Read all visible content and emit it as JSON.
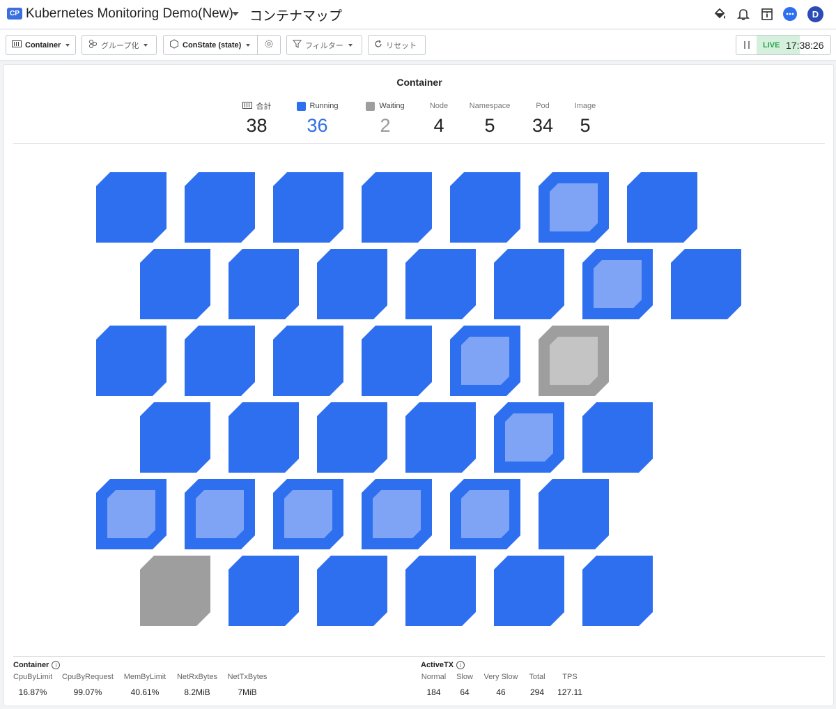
{
  "header": {
    "badge": "CP",
    "project_title": "Kubernetes Monitoring Demo(New)",
    "page_title": "コンテナマップ",
    "avatar_initial": "D"
  },
  "toolbar": {
    "container_label": "Container",
    "group_label": "グループ化",
    "state_label": "ConState (state)",
    "filter_label": "フィルター",
    "reset_label": "リセット",
    "live_label": "LIVE",
    "live_time": "17:38:26"
  },
  "summary": {
    "title": "Container",
    "stats": [
      {
        "label": "合計",
        "value": "38"
      },
      {
        "label": "Running",
        "value": "36"
      },
      {
        "label": "Waiting",
        "value": "2"
      },
      {
        "label": "Node",
        "value": "4"
      },
      {
        "label": "Namespace",
        "value": "5"
      },
      {
        "label": "Pod",
        "value": "34"
      },
      {
        "label": "Image",
        "value": "5"
      }
    ]
  },
  "colors": {
    "running": "#2e6ff0",
    "running_inner": "#7fa4f5",
    "waiting": "#9e9e9e",
    "waiting_inner": "#c4c4c4"
  },
  "map": {
    "rows": [
      [
        "running",
        "running",
        "running",
        "running",
        "running",
        "running-selected",
        "running"
      ],
      [
        "running",
        "running",
        "running",
        "running",
        "running",
        "running-selected",
        "running"
      ],
      [
        "running",
        "running",
        "running",
        "running",
        "running-selected",
        "waiting-selected"
      ],
      [
        "running",
        "running",
        "running",
        "running",
        "running-selected",
        "running"
      ],
      [
        "running-selected",
        "running-selected",
        "running-selected",
        "running-selected",
        "running-selected",
        "running"
      ],
      [
        "waiting",
        "running",
        "running",
        "running",
        "running",
        "running"
      ]
    ]
  },
  "container_metrics": {
    "title": "Container",
    "items": [
      {
        "label": "CpuByLimit",
        "value": "16.87%"
      },
      {
        "label": "CpuByRequest",
        "value": "99.07%"
      },
      {
        "label": "MemByLimit",
        "value": "40.61%"
      },
      {
        "label": "NetRxBytes",
        "value": "8.2MiB"
      },
      {
        "label": "NetTxBytes",
        "value": "7MiB"
      }
    ]
  },
  "activetx_metrics": {
    "title": "ActiveTX",
    "items": [
      {
        "label": "Normal",
        "value": "184"
      },
      {
        "label": "Slow",
        "value": "64"
      },
      {
        "label": "Very Slow",
        "value": "46"
      },
      {
        "label": "Total",
        "value": "294"
      },
      {
        "label": "TPS",
        "value": "127.11"
      }
    ]
  }
}
